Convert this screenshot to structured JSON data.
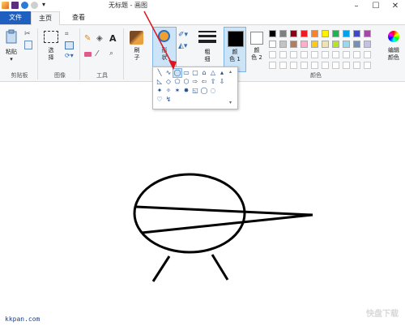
{
  "window": {
    "title": "无标题 - 画图"
  },
  "tabs": [
    {
      "label": "文件"
    },
    {
      "label": "主页"
    },
    {
      "label": "查看"
    }
  ],
  "ribbon": {
    "clipboard": {
      "paste_label": "粘贴",
      "group_label": "剪贴板"
    },
    "image": {
      "select_label": "选\n择",
      "group_label": "图像"
    },
    "tools": {
      "group_label": "工具"
    },
    "brushes": {
      "label": "刷\n子"
    },
    "shapes": {
      "label": "形\n状"
    },
    "size": {
      "label": "粗\n细"
    },
    "color1": {
      "label": "颜\n色 1"
    },
    "color2": {
      "label": "颜\n色 2"
    },
    "colors": {
      "group_label": "颜色",
      "edit_label": "编辑\n颜色"
    },
    "palette_row1": [
      "#000000",
      "#7f7f7f",
      "#880015",
      "#ed1c24",
      "#ff7f27",
      "#fff200",
      "#22b14c",
      "#00a2e8",
      "#3f48cc",
      "#a349a4"
    ],
    "palette_row2": [
      "#ffffff",
      "#c3c3c3",
      "#b97a57",
      "#ffaec9",
      "#ffc90e",
      "#efe4b0",
      "#b5e61d",
      "#99d9ea",
      "#7092be",
      "#c8bfe7"
    ],
    "color1_value": "#000000",
    "color2_value": "#ffffff"
  },
  "shapes_popup": {
    "row1": [
      "╲",
      "∿",
      "◯",
      "▭",
      "▢",
      "⌂",
      "△",
      "▴"
    ],
    "row2": [
      "◺",
      "◇",
      "⬠",
      "⬡",
      "⇨",
      "⇦",
      "⇧",
      "⇩"
    ],
    "row3": [
      "✦",
      "✧",
      "✶",
      "✸",
      "◱",
      "◯",
      "◌",
      ""
    ],
    "row4": [
      "♡",
      "↯",
      "",
      "",
      "",
      "",
      "",
      ""
    ]
  },
  "watermarks": {
    "left": "kkpan.com",
    "right": "快盘下载"
  }
}
